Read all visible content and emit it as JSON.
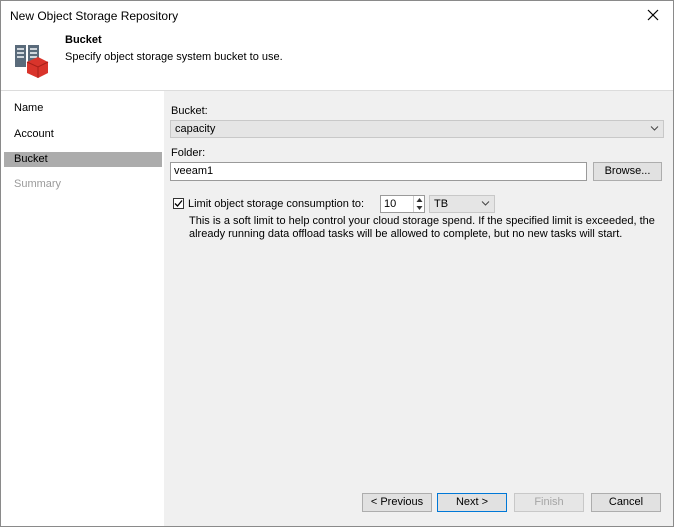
{
  "window": {
    "title": "New Object Storage Repository",
    "close_icon": "close-icon"
  },
  "header": {
    "title": "Bucket",
    "subtitle": "Specify object storage system bucket to use.",
    "logo_icon": "object-storage-icon"
  },
  "sidebar": {
    "items": [
      {
        "label": "Name",
        "state": "normal"
      },
      {
        "label": "Account",
        "state": "normal"
      },
      {
        "label": "Bucket",
        "state": "active"
      },
      {
        "label": "Summary",
        "state": "disabled"
      }
    ]
  },
  "form": {
    "bucket_label": "Bucket:",
    "bucket_value": "capacity",
    "folder_label": "Folder:",
    "folder_value": "veeam1",
    "browse_label": "Browse...",
    "limit_label": "Limit object storage consumption to:",
    "limit_checked": true,
    "limit_value": "10",
    "limit_unit": "TB",
    "limit_description": "This is a soft limit to help control your cloud storage spend. If the specified limit is exceeded, the already running data offload tasks will be allowed to complete, but no new tasks will start."
  },
  "footer": {
    "previous_label": "< Previous",
    "next_label": "Next >",
    "finish_label": "Finish",
    "cancel_label": "Cancel"
  },
  "colors": {
    "logo_red": "#d9342b",
    "logo_gray": "#5a6b7b",
    "active_step": "#acacac",
    "primary_border": "#0078d7"
  }
}
